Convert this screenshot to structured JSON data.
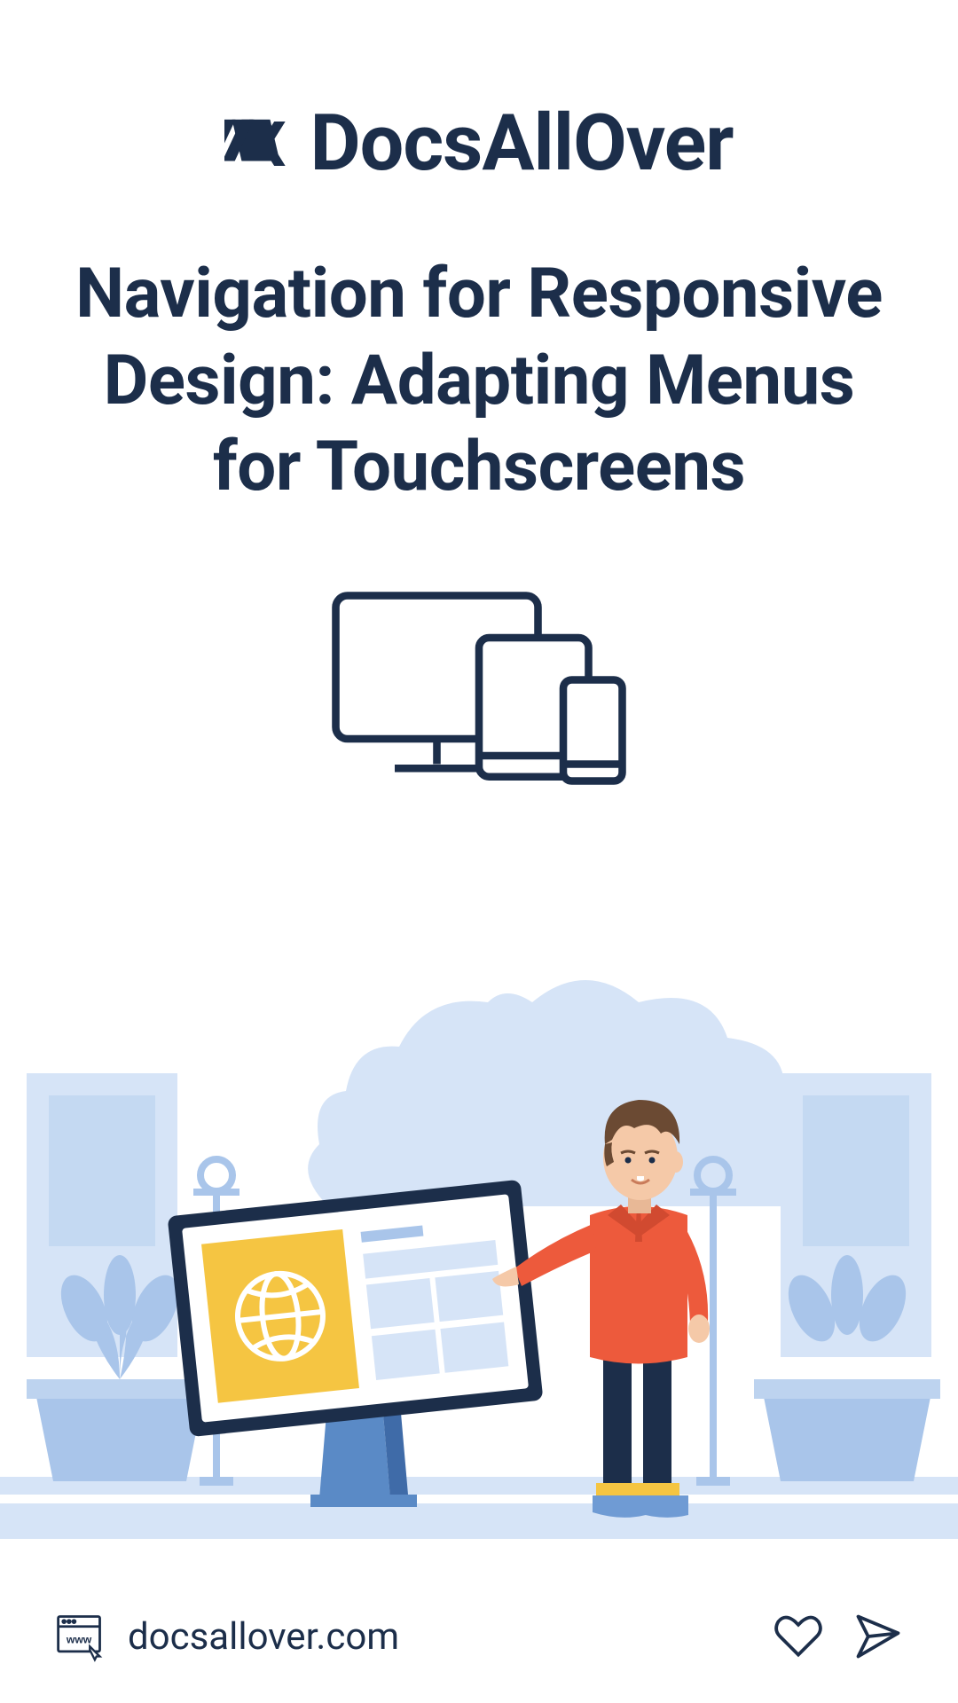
{
  "brand": "DocsAllOver",
  "title": "Navigation for Responsive Design: Adapting Menus for Touchscreens",
  "footer": {
    "url": "docsallover.com"
  },
  "colors": {
    "primary": "#1c2e4a",
    "lightBlue": "#d6e4f7",
    "mediumBlue": "#a9c5ea",
    "kioskBlue": "#5a8ac6",
    "yellow": "#f5c542",
    "red": "#ed5a3c",
    "brown": "#6b4a33",
    "skin": "#f5c9a8"
  }
}
